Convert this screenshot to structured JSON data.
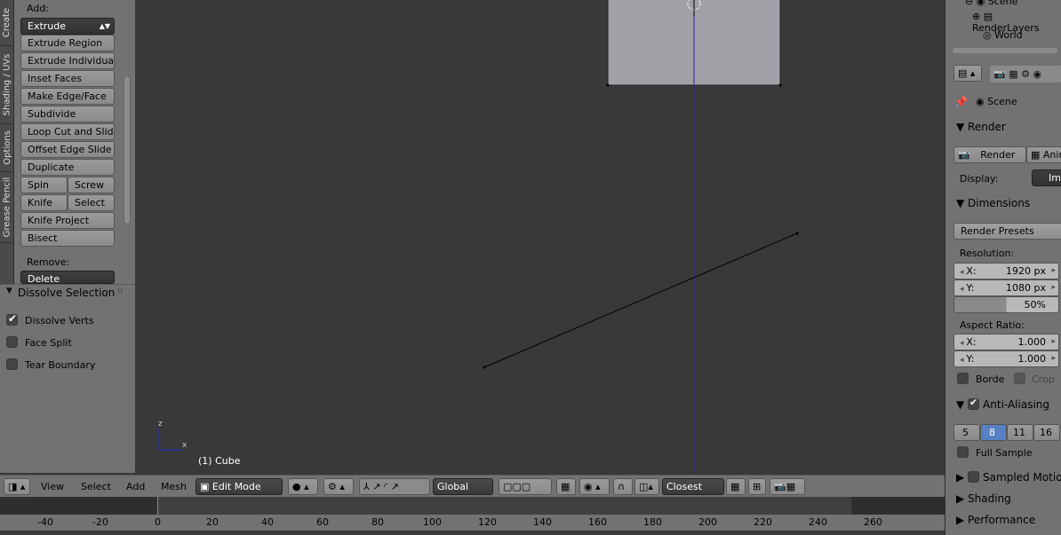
{
  "left_tabs": [
    "Create",
    "Shading / UVs",
    "Options",
    "Grease Pencil"
  ],
  "tools": {
    "add_label": "Add:",
    "extrude_select": "Extrude",
    "buttons": [
      "Extrude Region",
      "Extrude Individual",
      "Inset Faces",
      "Make Edge/Face",
      "Subdivide",
      "Loop Cut and Slide",
      "Offset Edge Slide",
      "Duplicate"
    ],
    "spin": "Spin",
    "screw": "Screw",
    "knife": "Knife",
    "select": "Select",
    "knife_project": "Knife Project",
    "bisect": "Bisect",
    "remove_label": "Remove:",
    "delete_select": "Delete"
  },
  "operator": {
    "title": "Dissolve Selection",
    "options": [
      {
        "label": "Dissolve Verts",
        "checked": true
      },
      {
        "label": "Face Split",
        "checked": false
      },
      {
        "label": "Tear Boundary",
        "checked": false
      }
    ]
  },
  "viewport": {
    "object_label": "(1) Cube",
    "axis_z": "z",
    "axis_x": "x"
  },
  "header": {
    "menus": [
      "View",
      "Select",
      "Add",
      "Mesh"
    ],
    "mode": "Edit Mode",
    "orientation": "Global",
    "snap": "Closest"
  },
  "timeline": {
    "ticks": [
      "-40",
      "-20",
      "0",
      "20",
      "40",
      "60",
      "80",
      "100",
      "120",
      "140",
      "160",
      "180",
      "200",
      "220",
      "240",
      "260"
    ]
  },
  "outliner": {
    "items": [
      "Scene",
      "RenderLayers",
      "World"
    ]
  },
  "properties": {
    "context": "Scene",
    "render_header": "Render",
    "render_btn": "Render",
    "anim_btn": "Anim",
    "display_label": "Display:",
    "display_value": "Image",
    "dimensions_header": "Dimensions",
    "render_presets": "Render Presets",
    "resolution_label": "Resolution:",
    "res_x_label": "X:",
    "res_x": "1920 px",
    "res_y_label": "Y:",
    "res_y": "1080 px",
    "res_pct": "50%",
    "aspect_label": "Aspect Ratio:",
    "asp_x_label": "X:",
    "asp_x": "1.000",
    "asp_y_label": "Y:",
    "asp_y": "1.000",
    "border": "Borde",
    "crop": "Crop",
    "aa_header": "Anti-Aliasing",
    "aa_values": [
      "5",
      "8",
      "11",
      "16"
    ],
    "full_sample": "Full Sample",
    "sampled_motion": "Sampled Motion",
    "shading": "Shading",
    "performance": "Performance"
  },
  "colors": {
    "accent": "#5680c2",
    "viewport_bg": "#393939",
    "panel": "#727272"
  }
}
